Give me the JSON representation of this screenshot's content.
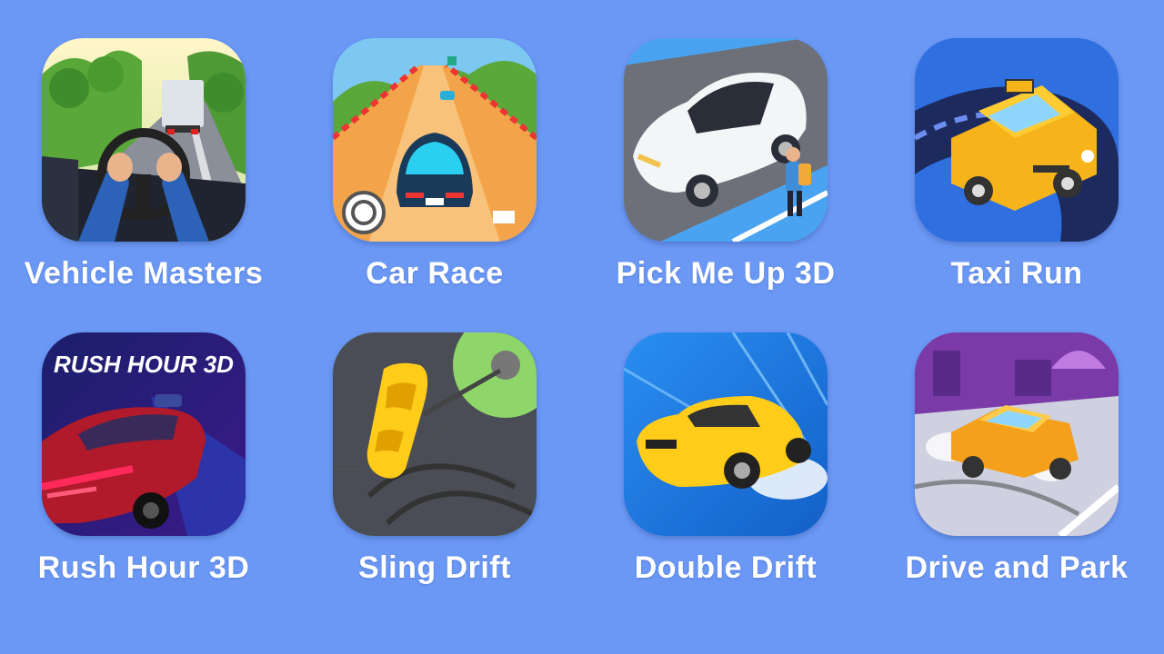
{
  "games": [
    {
      "title": "Vehicle Masters",
      "icon": "steering-wheel-icon"
    },
    {
      "title": "Car Race",
      "icon": "race-car-icon"
    },
    {
      "title": "Pick Me Up 3D",
      "icon": "white-sedan-icon"
    },
    {
      "title": "Taxi Run",
      "icon": "taxi-icon"
    },
    {
      "title": "Rush Hour 3D",
      "icon": "neon-car-icon",
      "logo_text": "RUSH HOUR 3D"
    },
    {
      "title": "Sling Drift",
      "icon": "sling-car-icon"
    },
    {
      "title": "Double Drift",
      "icon": "yellow-muscle-car-icon"
    },
    {
      "title": "Drive and Park",
      "icon": "orange-car-icon"
    }
  ],
  "colors": {
    "background": "#6b98f5",
    "label": "#ffffff"
  }
}
